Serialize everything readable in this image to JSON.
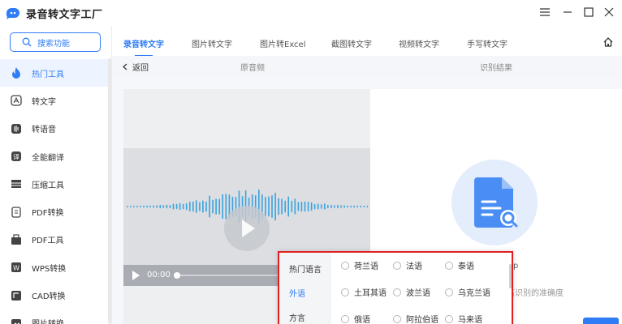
{
  "app": {
    "title": "录音转文字工厂"
  },
  "sidebar": {
    "search_label": "搜索功能",
    "items": [
      {
        "label": "热门工具",
        "icon": "fire-icon",
        "active": true
      },
      {
        "label": "转文字",
        "icon": "text-convert-icon"
      },
      {
        "label": "转语音",
        "icon": "voice-icon"
      },
      {
        "label": "全能翻译",
        "icon": "translate-icon"
      },
      {
        "label": "压缩工具",
        "icon": "compress-icon"
      },
      {
        "label": "PDF转换",
        "icon": "pdf-convert-icon"
      },
      {
        "label": "PDF工具",
        "icon": "pdf-tools-icon"
      },
      {
        "label": "WPS转换",
        "icon": "wps-icon"
      },
      {
        "label": "CAD转换",
        "icon": "cad-icon"
      },
      {
        "label": "图片转换",
        "icon": "image-convert-icon"
      }
    ]
  },
  "tabs": [
    {
      "label": "录音转文字",
      "active": true
    },
    {
      "label": "图片转文字"
    },
    {
      "label": "图片转Excel"
    },
    {
      "label": "截图转文字"
    },
    {
      "label": "视频转文字"
    },
    {
      "label": "手写转文字"
    }
  ],
  "subheader": {
    "back_label": "返回",
    "original_label": "原音频",
    "result_label": "识别结果"
  },
  "player": {
    "time": "00:00"
  },
  "result": {
    "hint_text": "高识别的准确度",
    "hint_p": "p"
  },
  "language_popup": {
    "categories": [
      {
        "label": "热门语言"
      },
      {
        "label": "外语",
        "active": true
      },
      {
        "label": "方言"
      }
    ],
    "rows": [
      [
        "荷兰语",
        "法语",
        "泰语"
      ],
      [
        "土耳其语",
        "波兰语",
        "乌克兰语"
      ],
      [
        "俄语",
        "阿拉伯语",
        "马来语"
      ]
    ]
  },
  "colors": {
    "accent": "#2f7cf6",
    "highlight_border": "#e02020",
    "active_bg": "#edf4ff"
  }
}
